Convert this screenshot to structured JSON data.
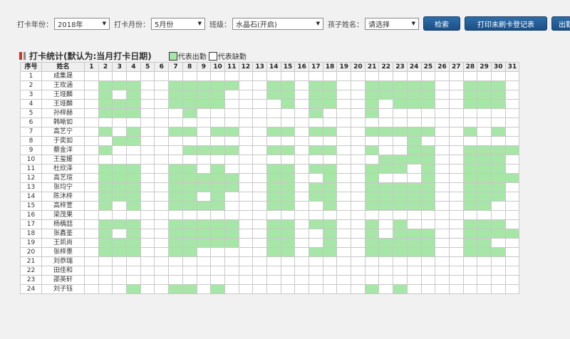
{
  "filters": {
    "year_label": "打卡年份：",
    "year_value": "2018年",
    "month_label": "打卡月份：",
    "month_value": "5月份",
    "class_label": "班级：",
    "class_value": "水晶石(开启)",
    "child_label": "孩子姓名：",
    "child_value": "请选择"
  },
  "buttons": {
    "search": "检索",
    "print": "打印未刷卡登记表",
    "export": "出勤登记"
  },
  "section": {
    "title": "打卡统计(默认为:当月打卡日期)",
    "legend_present": "代表出勤",
    "legend_absent": "代表缺勤"
  },
  "colors": {
    "present": "#a6e6a6",
    "absent": "#ffffff"
  },
  "table": {
    "col_index": "序号",
    "col_name": "姓名",
    "days": [
      "1",
      "2",
      "3",
      "4",
      "5",
      "6",
      "7",
      "8",
      "9",
      "10",
      "11",
      "12",
      "13",
      "14",
      "15",
      "16",
      "17",
      "18",
      "19",
      "20",
      "21",
      "22",
      "23",
      "24",
      "25",
      "26",
      "27",
      "28",
      "29",
      "30",
      "31"
    ],
    "rows": [
      {
        "no": "1",
        "name": "成集晟",
        "days": []
      },
      {
        "no": "2",
        "name": "王玫涵",
        "days": [
          2,
          3,
          4,
          7,
          8,
          9,
          10,
          11,
          14,
          15,
          17,
          18,
          21,
          22,
          23,
          24,
          25,
          28,
          29,
          30
        ]
      },
      {
        "no": "3",
        "name": "王垭麟",
        "days": [
          2,
          4,
          7,
          8,
          9,
          10,
          14,
          15,
          17,
          18,
          21,
          22,
          23,
          24,
          25,
          28,
          29,
          30
        ]
      },
      {
        "no": "4",
        "name": "王垭麟",
        "days": [
          2,
          3,
          4,
          7,
          8,
          9,
          10,
          15,
          17,
          18,
          21,
          23,
          24,
          25,
          28,
          29,
          30
        ]
      },
      {
        "no": "5",
        "name": "孙梓赫",
        "days": [
          2,
          3,
          4,
          8,
          17,
          21
        ]
      },
      {
        "no": "6",
        "name": "韩晰如",
        "days": []
      },
      {
        "no": "7",
        "name": "高艺宁",
        "days": [
          2,
          4,
          7,
          8,
          10,
          11,
          14,
          15,
          17,
          18,
          21,
          22,
          23,
          24,
          25,
          28,
          30
        ]
      },
      {
        "no": "8",
        "name": "于奕如",
        "days": [
          3,
          4,
          24
        ]
      },
      {
        "no": "9",
        "name": "蔡金洋",
        "days": [
          2,
          8,
          9,
          10,
          11,
          14,
          15,
          17,
          18,
          21,
          24,
          25,
          28,
          29,
          30,
          31
        ]
      },
      {
        "no": "10",
        "name": "王玺媛",
        "days": [
          22,
          23,
          24,
          25,
          28,
          29,
          30
        ]
      },
      {
        "no": "11",
        "name": "杜欣泽",
        "days": [
          2,
          3,
          4,
          7,
          8,
          10,
          14,
          15,
          17,
          18,
          21,
          22,
          23,
          25,
          28,
          29,
          30
        ]
      },
      {
        "no": "12",
        "name": "高艺瑄",
        "days": [
          2,
          3,
          4,
          7,
          8,
          9,
          10,
          11,
          14,
          15,
          18,
          21,
          25,
          28,
          29,
          30,
          31
        ]
      },
      {
        "no": "13",
        "name": "张均宁",
        "days": [
          2,
          3,
          4,
          7,
          8,
          9,
          10,
          11,
          14,
          15,
          17,
          18,
          21,
          22,
          23,
          24,
          25,
          28,
          29,
          30
        ]
      },
      {
        "no": "14",
        "name": "陈沐梓",
        "days": [
          2,
          3,
          4,
          7,
          8,
          10,
          14,
          15,
          17,
          18,
          21,
          22,
          23,
          24,
          25,
          28,
          29,
          30
        ]
      },
      {
        "no": "15",
        "name": "高梓萱",
        "days": [
          2,
          4,
          7,
          8,
          9,
          10,
          14,
          15,
          18,
          21,
          22,
          23,
          24,
          25,
          28,
          29
        ]
      },
      {
        "no": "16",
        "name": "梁茂果",
        "days": []
      },
      {
        "no": "17",
        "name": "杨楀喆",
        "days": [
          2,
          3,
          4,
          7,
          8,
          9,
          10,
          11,
          14,
          15,
          17,
          18,
          21,
          23,
          28,
          29,
          30
        ]
      },
      {
        "no": "18",
        "name": "张鑫鉴",
        "days": [
          2,
          4,
          7,
          8,
          9,
          10,
          11,
          14,
          15,
          18,
          21,
          23,
          24,
          25,
          28,
          29,
          30,
          31
        ]
      },
      {
        "no": "19",
        "name": "王凯尚",
        "days": [
          2,
          3,
          4,
          7,
          8,
          9,
          10,
          11,
          14,
          15,
          18,
          21,
          22,
          23,
          24,
          25,
          28,
          29
        ]
      },
      {
        "no": "20",
        "name": "张梓墨",
        "days": [
          2,
          3,
          4,
          7,
          8,
          14,
          15,
          17,
          18,
          21,
          22,
          23,
          24,
          25,
          28,
          29,
          30
        ]
      },
      {
        "no": "21",
        "name": "刘恭瑞",
        "days": []
      },
      {
        "no": "22",
        "name": "田佳和",
        "days": []
      },
      {
        "no": "23",
        "name": "邵英轩",
        "days": []
      },
      {
        "no": "24",
        "name": "刘子钰",
        "days": [
          4,
          7,
          8,
          10,
          21,
          23
        ]
      }
    ]
  }
}
